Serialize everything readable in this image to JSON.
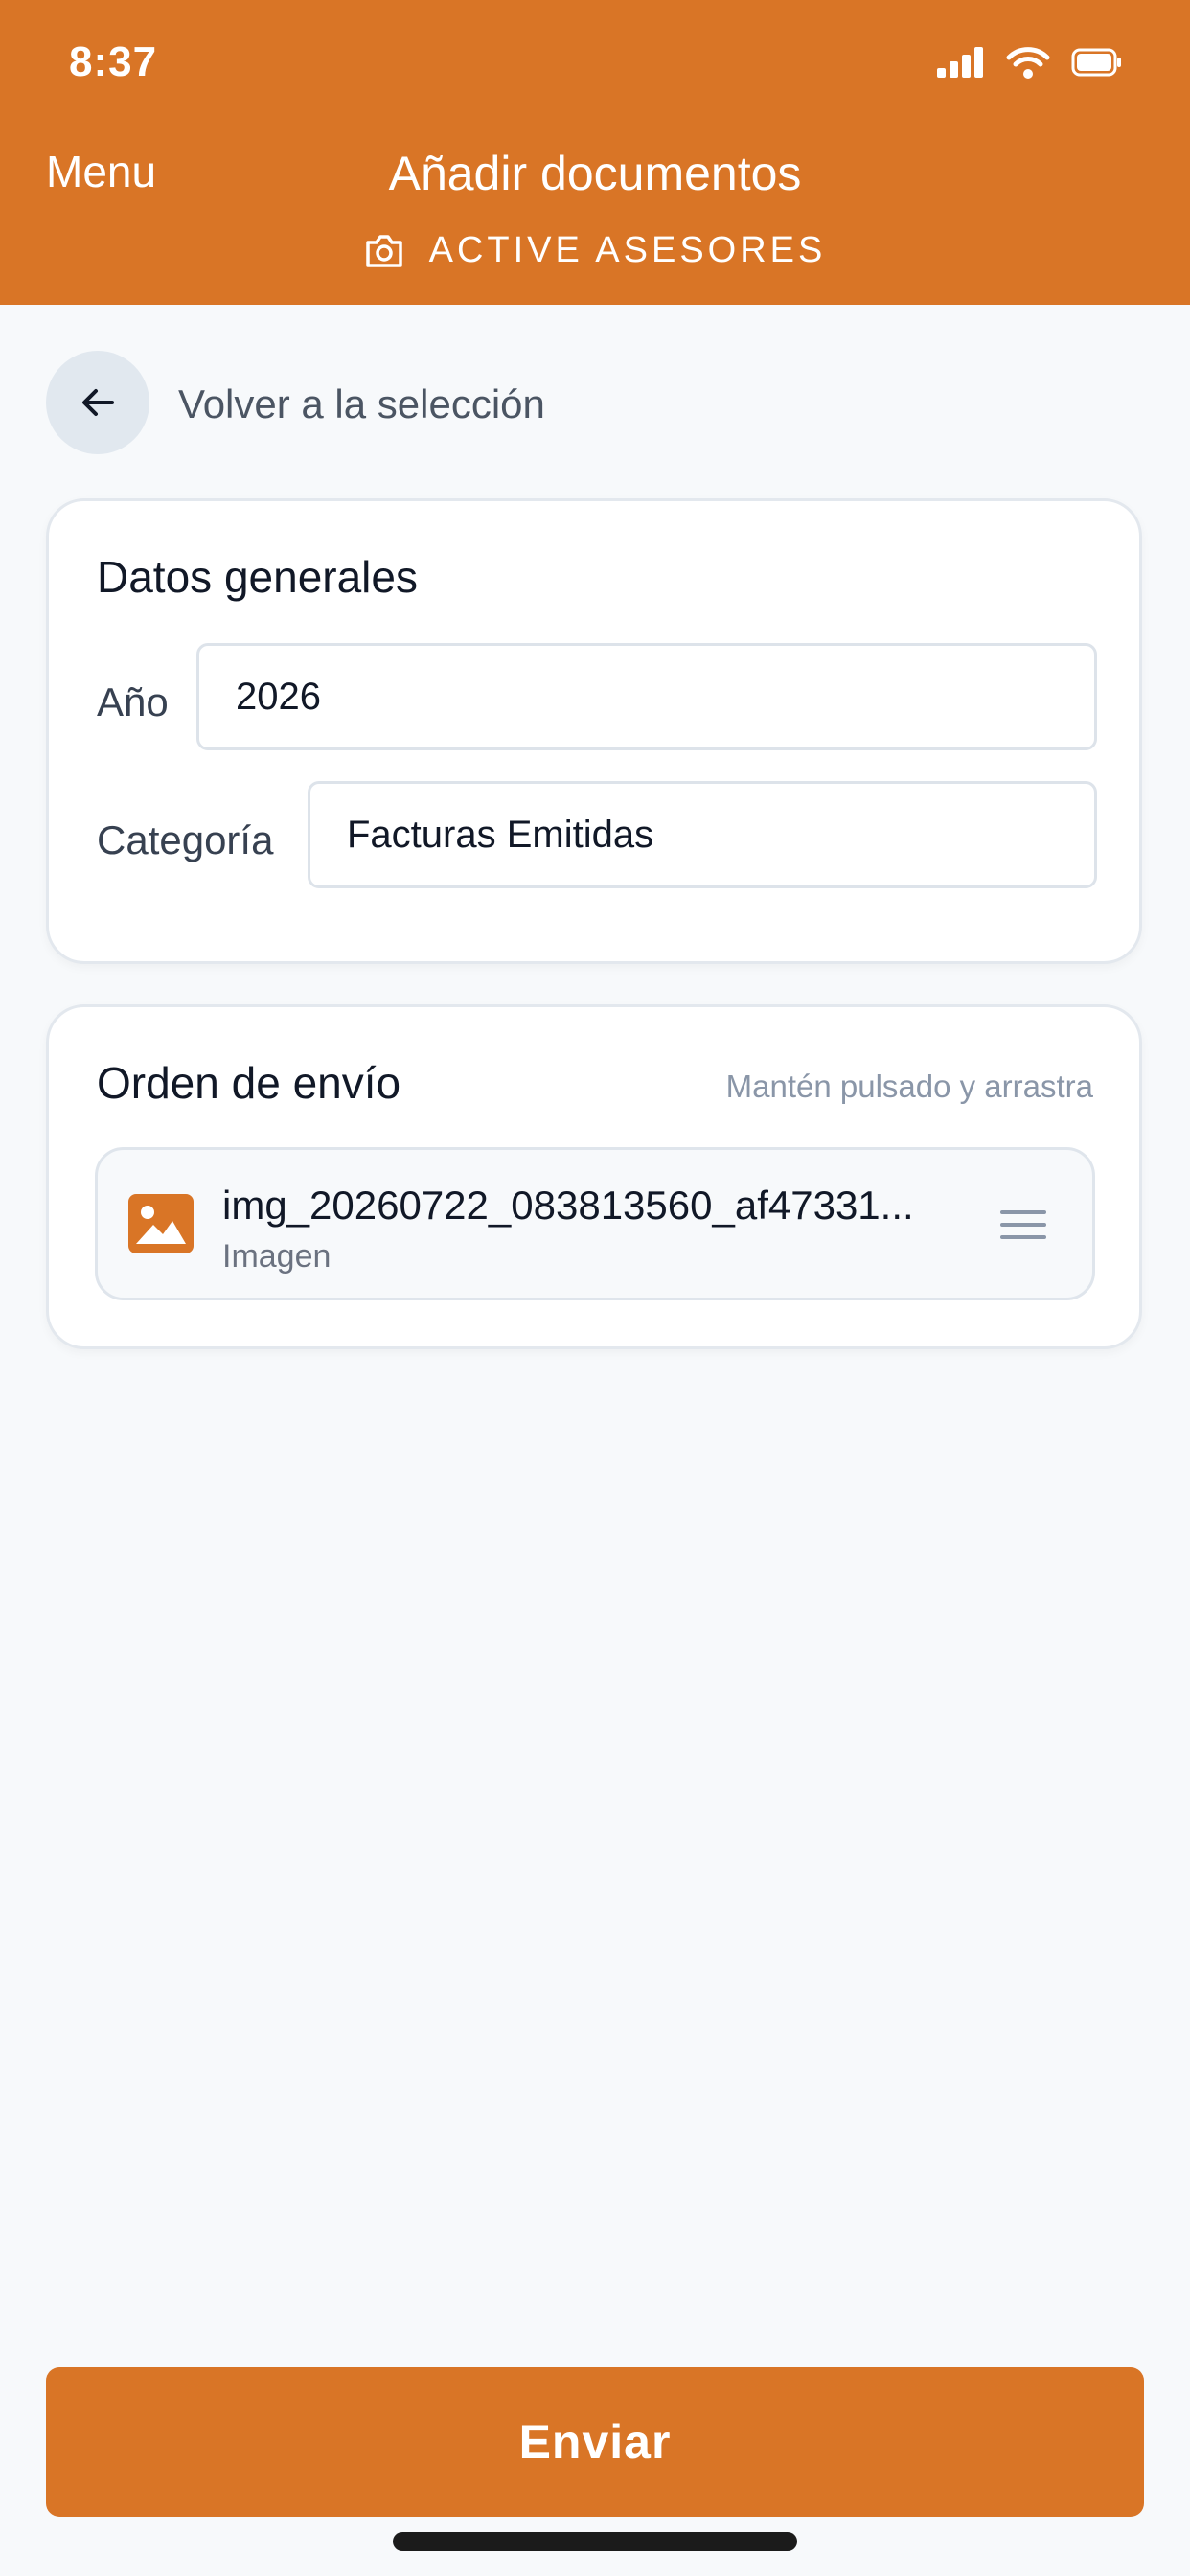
{
  "status_bar": {
    "time": "8:37"
  },
  "header": {
    "menu_label": "Menu",
    "title": "Añadir documentos",
    "subtitle": "ACTIVE ASESORES",
    "color": "#d97526"
  },
  "back": {
    "label": "Volver a la selección"
  },
  "general": {
    "title": "Datos generales",
    "year_label": "Año",
    "year_value": "2026",
    "category_label": "Categoría",
    "category_value": "Facturas Emitidas"
  },
  "order": {
    "title": "Orden de envío",
    "hint": "Mantén pulsado y arrastra",
    "documents": [
      {
        "name": "img_20260722_083813560_af47331...",
        "type": "Imagen",
        "icon": "image-icon"
      }
    ]
  },
  "submit": {
    "label": "Enviar"
  }
}
